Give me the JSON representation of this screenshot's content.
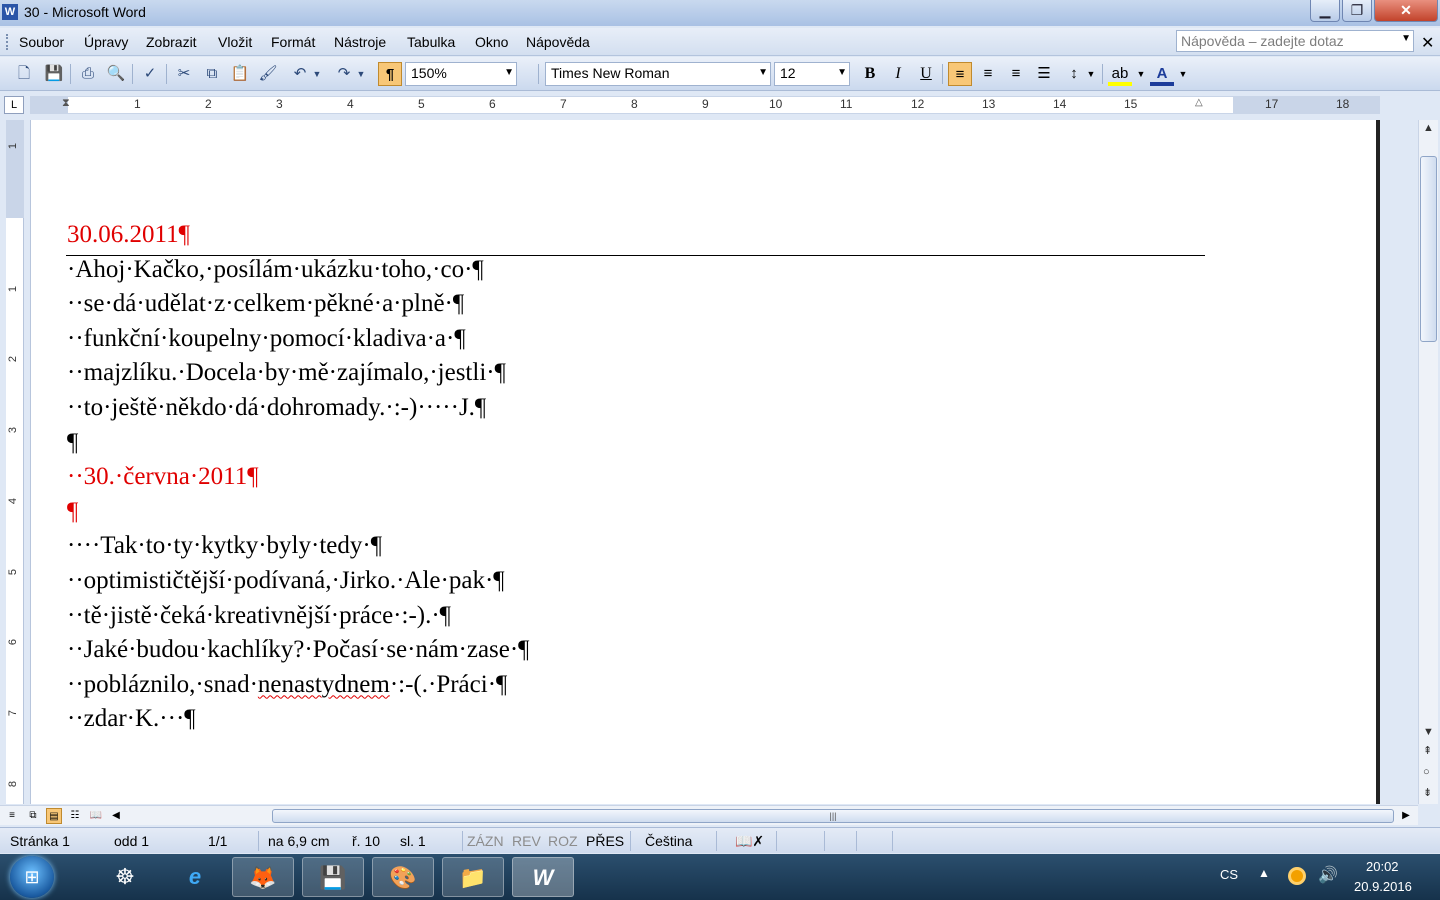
{
  "window": {
    "title": "30 - Microsoft Word",
    "app_icon": "W"
  },
  "menu": {
    "items": [
      {
        "label": "Soubor",
        "name": "menu-soubor"
      },
      {
        "label": "Úpravy",
        "name": "menu-upravy"
      },
      {
        "label": "Zobrazit",
        "name": "menu-zobrazit"
      },
      {
        "label": "Vložit",
        "name": "menu-vlozit"
      },
      {
        "label": "Formát",
        "name": "menu-format"
      },
      {
        "label": "Nástroje",
        "name": "menu-nastroje"
      },
      {
        "label": "Tabulka",
        "name": "menu-tabulka"
      },
      {
        "label": "Okno",
        "name": "menu-okno"
      },
      {
        "label": "Nápověda",
        "name": "menu-napoveda"
      }
    ],
    "help_placeholder": "Nápověda – zadejte dotaz"
  },
  "toolbar": {
    "zoom": "150%",
    "font_name": "Times New Roman",
    "font_size": "12",
    "bold": "B",
    "italic": "I",
    "underline": "U",
    "pilcrow": "¶"
  },
  "ruler": {
    "h_numbers": [
      "1",
      "2",
      "3",
      "4",
      "5",
      "6",
      "7",
      "8",
      "9",
      "10",
      "11",
      "12",
      "13",
      "14",
      "15",
      "",
      "17",
      "18"
    ],
    "v_numbers": [
      "1",
      "1",
      "2",
      "3",
      "4",
      "5",
      "6",
      "7",
      "8"
    ]
  },
  "document": {
    "heading": "30.06.2011¶",
    "lines": [
      "·Ahoj·Kačko,·posílám·ukázku·toho,·co·¶",
      "··se·dá·udělat·z·celkem·pěkné·a·plně·¶",
      "··funkční·koupelny·pomocí·kladiva·a·¶",
      "··majzlíku.·Docela·by·mě·zajímalo,·jestli·¶",
      "··to·ještě·někdo·dá·dohromady.·:-)·····J.¶",
      "¶"
    ],
    "subheading": "··30.·června·2011¶",
    "red_pilcrow": "¶",
    "lines2": [
      "····Tak·to·ty·kytky·byly·tedy·¶",
      "··optimističtější·podívaná,·Jirko.·Ale·pak·¶",
      "··tě·jistě·čeká·kreativnější·práce·:-).·¶",
      "··Jaké·budou·kachlíky?·Počasí·se·nám·zase·¶"
    ],
    "line_pre_squiggle": "··pobláznilo,·snad·",
    "squiggle_word": "nenastydnem",
    "line_post_squiggle": "·:-(.·Práci·¶",
    "last_line": "··zdar·K.···¶"
  },
  "status": {
    "page": "Stránka 1",
    "section": "odd 1",
    "pages": "1/1",
    "at": "na 6,9 cm",
    "line": "ř. 10",
    "col": "sl. 1",
    "rec": "ZÁZN",
    "trk": "REV",
    "ext": "ROZ",
    "ovr": "PŘES",
    "language": "Čeština"
  },
  "taskbar": {
    "start_glyph": "⊞",
    "lang": "CS",
    "time": "20:02",
    "date": "20.9.2016"
  },
  "colors": {
    "heading": "#e00000",
    "active_button": "#f8c777"
  }
}
